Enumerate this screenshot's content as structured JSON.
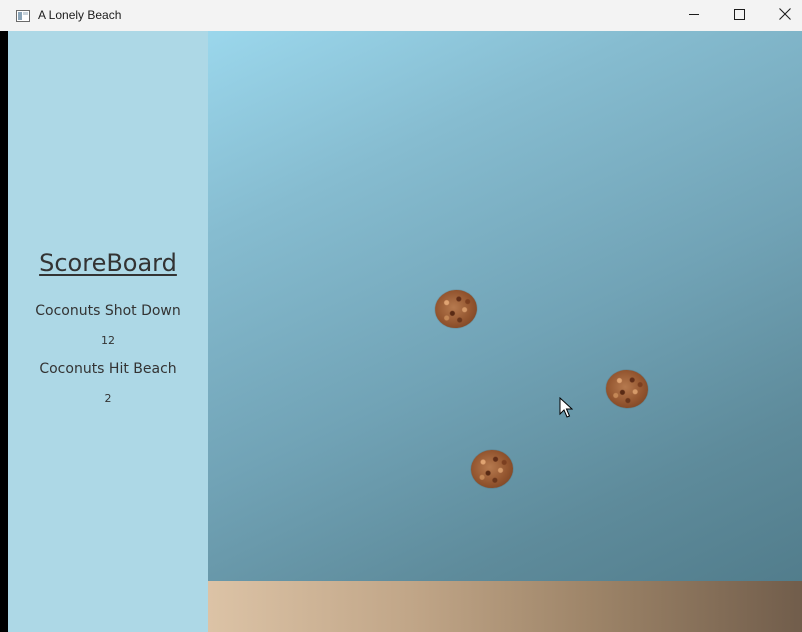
{
  "window": {
    "title": "A Lonely Beach"
  },
  "scoreboard": {
    "title": "ScoreBoard",
    "shot_down_label": "Coconuts Shot Down",
    "shot_down_value": "12",
    "hit_beach_label": "Coconuts Hit Beach",
    "hit_beach_value": "2"
  },
  "colors": {
    "scoreboard_bg": "#add8e6",
    "sky_top": "#9bd7ec",
    "sky_bottom": "#527d8c",
    "beach_left": "#dcc3a6",
    "beach_right": "#715d4b",
    "coconut": "#93552f"
  },
  "icons": {
    "app": "window-icon",
    "minimize": "minimize-icon",
    "maximize": "maximize-icon",
    "close": "close-icon",
    "cursor": "mouse-pointer-icon"
  }
}
